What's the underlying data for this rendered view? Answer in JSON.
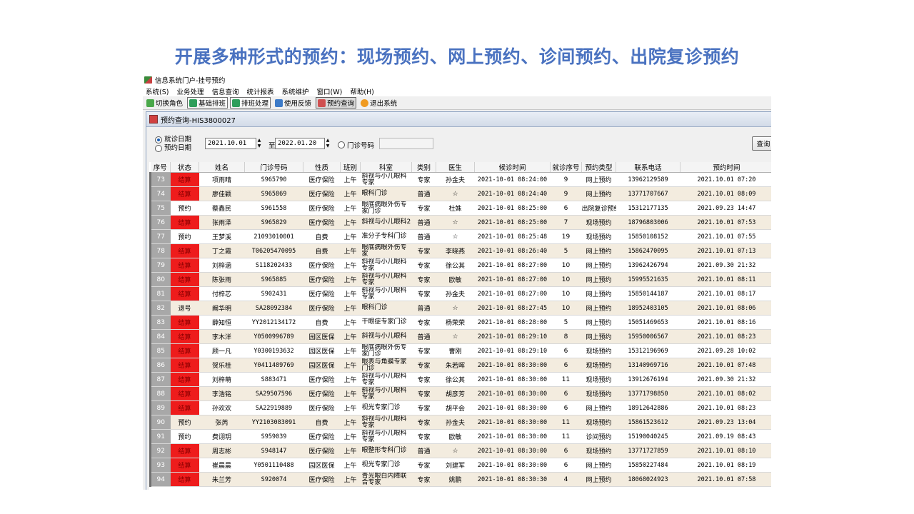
{
  "slide_title": "开展多种形式的预约：现场预约、网上预约、诊间预约、出院复诊预约",
  "window": {
    "title": "信息系统门户-挂号预约"
  },
  "menu": [
    "系统(S)",
    "业务处理",
    "信息查询",
    "统计报表",
    "系统维护",
    "窗口(W)",
    "帮助(H)"
  ],
  "toolbar": {
    "switch_role": "切换角色",
    "base_schedule": "基础排班",
    "schedule_process": "排班处理",
    "feedback": "使用反馈",
    "appointment_query": "预约查询",
    "exit": "退出系统"
  },
  "subwindow": {
    "title": "预约查询-HIS3800027"
  },
  "filter": {
    "visit_date_label": "就诊日期",
    "booking_date_label": "预约日期",
    "date_from": "2021.10.01",
    "to_label": "至",
    "date_to": "2022.01.20",
    "clinic_no_label": "门诊号码",
    "query_button": "查询"
  },
  "table": {
    "headers": [
      "序号",
      "状态",
      "姓名",
      "门诊号码",
      "性质",
      "班别",
      "科室",
      "类别",
      "医生",
      "候诊时间",
      "就诊序号",
      "预约类型",
      "联系电话",
      "预约时间"
    ],
    "rows": [
      [
        "73",
        "结算",
        "项雨晴",
        "S965790",
        "医疗保险",
        "上午",
        "斜视与小儿眼科专家",
        "专家",
        "孙金夫",
        "2021-10-01 08:24:00",
        "9",
        "网上预约",
        "13962129589",
        "2021.10.01 07:20"
      ],
      [
        "74",
        "结算",
        "廖佳颖",
        "S965869",
        "医疗保险",
        "上午",
        "眼科门诊",
        "普通",
        "☆",
        "2021-10-01 08:24:40",
        "9",
        "网上预约",
        "13771707667",
        "2021.10.01 08:09"
      ],
      [
        "75",
        "预约",
        "蔡鑫民",
        "S961558",
        "医疗保险",
        "上午",
        "眼底病眼外伤专家门诊",
        "专家",
        "杜姝",
        "2021-10-01 08:25:00",
        "6",
        "出院复诊预约",
        "15312177135",
        "2021.09.23 14:47"
      ],
      [
        "76",
        "结算",
        "张雨泽",
        "S965829",
        "医疗保险",
        "上午",
        "斜视与小儿眼科2",
        "普通",
        "☆",
        "2021-10-01 08:25:00",
        "7",
        "现场预约",
        "18796803006",
        "2021.10.01 07:53"
      ],
      [
        "77",
        "预约",
        "王梦溪",
        "21093010001",
        "自费",
        "上午",
        "准分子专科门诊",
        "普通",
        "☆",
        "2021-10-01 08:25:48",
        "19",
        "现场预约",
        "15850108152",
        "2021.10.01 07:55"
      ],
      [
        "78",
        "结算",
        "丁之霞",
        "T06205470095",
        "自费",
        "上午",
        "眼底病眼外伤专家",
        "专家",
        "李晓燕",
        "2021-10-01 08:26:40",
        "5",
        "网上预约",
        "15862470095",
        "2021.10.01 07:13"
      ],
      [
        "79",
        "结算",
        "刘梓涵",
        "S118202433",
        "医疗保险",
        "上午",
        "斜视与小儿眼科专家",
        "专家",
        "徐公其",
        "2021-10-01 08:27:00",
        "10",
        "网上预约",
        "13962426794",
        "2021.09.30 21:32"
      ],
      [
        "80",
        "结算",
        "陈张雨",
        "S965885",
        "医疗保险",
        "上午",
        "斜视与小儿眼科专家",
        "专家",
        "欧敏",
        "2021-10-01 08:27:00",
        "10",
        "网上预约",
        "15995521635",
        "2021.10.01 08:11"
      ],
      [
        "81",
        "结算",
        "付梓芯",
        "S902431",
        "医疗保险",
        "上午",
        "斜视与小儿眼科专家",
        "专家",
        "孙金夫",
        "2021-10-01 08:27:00",
        "10",
        "网上预约",
        "15850144187",
        "2021.10.01 08:17"
      ],
      [
        "82",
        "退号",
        "阚华明",
        "SA28092384",
        "医疗保险",
        "上午",
        "眼科门诊",
        "普通",
        "☆",
        "2021-10-01 08:27:45",
        "10",
        "网上预约",
        "18952403105",
        "2021.10.01 08:06"
      ],
      [
        "83",
        "结算",
        "薛知恒",
        "YY2012134172",
        "自费",
        "上午",
        "干眼症专家门诊",
        "专家",
        "杨荣荣",
        "2021-10-01 08:28:00",
        "5",
        "网上预约",
        "15051469653",
        "2021.10.01 08:16"
      ],
      [
        "84",
        "结算",
        "李木洋",
        "Y0500996789",
        "园区医保",
        "上午",
        "斜视与小儿眼科",
        "普通",
        "☆",
        "2021-10-01 08:29:10",
        "8",
        "网上预约",
        "15950006567",
        "2021.10.01 08:23"
      ],
      [
        "85",
        "结算",
        "顾一凡",
        "Y0300193632",
        "园区医保",
        "上午",
        "眼底病眼外伤专家门诊",
        "专家",
        "曹刚",
        "2021-10-01 08:29:10",
        "6",
        "现场预约",
        "15312196969",
        "2021.09.28 10:02"
      ],
      [
        "86",
        "结算",
        "贺乐桂",
        "Y0411489769",
        "园区医保",
        "上午",
        "眼表与角膜专家门诊",
        "专家",
        "朱若晖",
        "2021-10-01 08:30:00",
        "6",
        "现场预约",
        "13140969716",
        "2021.10.01 07:48"
      ],
      [
        "87",
        "结算",
        "刘梓萌",
        "S883471",
        "医疗保险",
        "上午",
        "斜视与小儿眼科专家",
        "专家",
        "徐公其",
        "2021-10-01 08:30:00",
        "11",
        "现场预约",
        "13912676194",
        "2021.09.30 21:32"
      ],
      [
        "88",
        "结算",
        "李浩铭",
        "SA29507596",
        "医疗保险",
        "上午",
        "斜视与小儿眼科专家",
        "专家",
        "胡彦芳",
        "2021-10-01 08:30:00",
        "6",
        "现场预约",
        "13771798850",
        "2021.10.01 08:02"
      ],
      [
        "89",
        "结算",
        "孙欢欢",
        "SA22919889",
        "医疗保险",
        "上午",
        "视光专家门诊",
        "专家",
        "胡平会",
        "2021-10-01 08:30:00",
        "6",
        "网上预约",
        "18912642886",
        "2021.10.01 08:23"
      ],
      [
        "90",
        "预约",
        "张芮",
        "YY2103083091",
        "自费",
        "上午",
        "斜视与小儿眼科专家",
        "专家",
        "孙金夫",
        "2021-10-01 08:30:00",
        "11",
        "现场预约",
        "15861523612",
        "2021.09.23 13:04"
      ],
      [
        "91",
        "预约",
        "费诩玥",
        "S959039",
        "医疗保险",
        "上午",
        "斜视与小儿眼科专家",
        "专家",
        "欧敏",
        "2021-10-01 08:30:00",
        "11",
        "诊间预约",
        "15190040245",
        "2021.09.19 08:43"
      ],
      [
        "92",
        "结算",
        "周志彬",
        "S948147",
        "医疗保险",
        "上午",
        "眼整形专科门诊",
        "普通",
        "☆",
        "2021-10-01 08:30:00",
        "6",
        "现场预约",
        "13771727859",
        "2021.10.01 08:10"
      ],
      [
        "93",
        "结算",
        "崔晨晨",
        "Y0501110488",
        "园区医保",
        "上午",
        "视光专家门诊",
        "专家",
        "刘建军",
        "2021-10-01 08:30:00",
        "6",
        "网上预约",
        "15850227484",
        "2021.10.01 08:19"
      ],
      [
        "94",
        "结算",
        "朱兰芳",
        "S920074",
        "医疗保险",
        "上午",
        "青光眼白内障联合专家",
        "专家",
        "姚鹏",
        "2021-10-01 08:30:30",
        "4",
        "网上预约",
        "18068024923",
        "2021.10.01 07:58"
      ]
    ]
  }
}
